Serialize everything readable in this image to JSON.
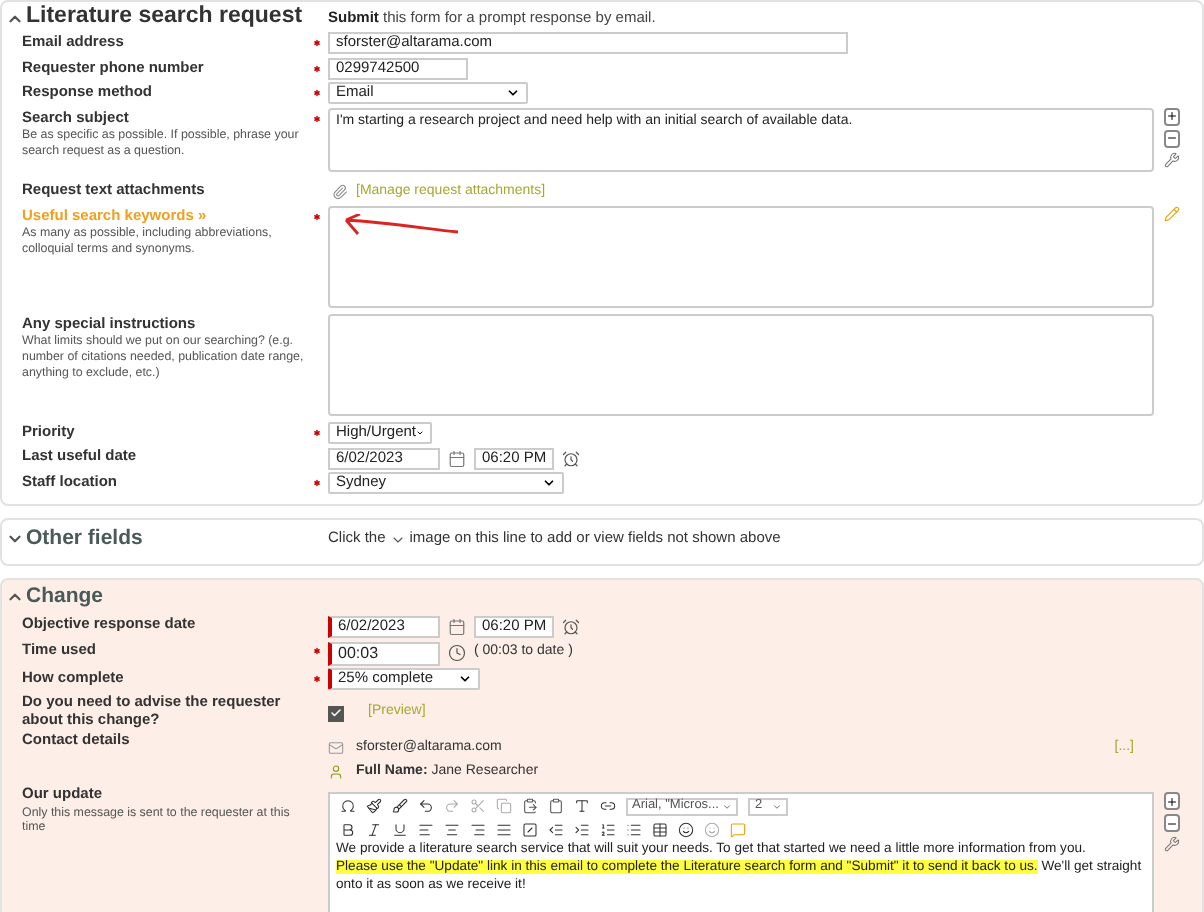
{
  "sections": [
    {
      "kind": "form",
      "title": "Literature search request",
      "expanded": true,
      "intro": "**Submit** this form for a prompt response by email.",
      "rows": [
        {
          "kind": "text",
          "label": "Email address",
          "required": true,
          "value": "sforster@altarama.com",
          "wide": true
        },
        {
          "kind": "text",
          "label": "Requester phone number",
          "required": true,
          "value": "0299742500",
          "wide": false
        },
        {
          "kind": "select",
          "label": "Response method",
          "required": true,
          "value": "Email"
        },
        {
          "kind": "textarea",
          "label": "Search subject",
          "hint": "Be as specific as possible. If possible, phrase your search request as a question.",
          "required": true,
          "value": "I'm starting a research project and need help with an initial search of available data.",
          "tools": true
        },
        {
          "kind": "attachments",
          "label": "Request text attachments",
          "required": false,
          "link": "[Manage request attachments]"
        },
        {
          "kind": "textarea",
          "label": "Useful search keywords »",
          "label_link": true,
          "hint": "As many as possible, including abbreviations, colloquial terms and synonyms.",
          "required": true,
          "value": "",
          "tools": false,
          "edit_icon": true,
          "annotated": true
        },
        {
          "kind": "textarea",
          "label": "Any special instructions",
          "hint": "What limits should we put on our searching? (e.g. number of citations needed, publication date range, anything to exclude, etc.)",
          "required": false,
          "value": "",
          "tools": false
        },
        {
          "kind": "select",
          "label": "Priority",
          "required": true,
          "value": "High/Urgent"
        },
        {
          "kind": "datetime",
          "label": "Last useful date",
          "required": false,
          "date": "6/02/2023",
          "time": "06:20 PM",
          "flagged": false
        },
        {
          "kind": "select",
          "label": "Staff location",
          "required": true,
          "value": "Sydney",
          "wide": true
        }
      ]
    },
    {
      "kind": "collapsed",
      "title": "Other fields",
      "expanded": false,
      "note_before": "Click the",
      "note_after": "image on this line to add or view fields not shown above"
    },
    {
      "kind": "form",
      "title": "Change",
      "expanded": true,
      "tinted": true,
      "rows": [
        {
          "kind": "datetime",
          "label": "Objective response date",
          "required": false,
          "date": "6/02/2023",
          "time": "06:20 PM",
          "flagged": true
        },
        {
          "kind": "timeused",
          "label": "Time used",
          "required": true,
          "value": "00:03",
          "note": "( 00:03 to date )",
          "flagged": true
        },
        {
          "kind": "select",
          "label": "How complete",
          "required": true,
          "value": "25% complete",
          "flagged": true
        },
        {
          "kind": "checkbox",
          "label": "Do you need to advise the requester about this change?",
          "required": false,
          "checked": true,
          "link": "[Preview]"
        },
        {
          "kind": "contact",
          "label": "Contact details",
          "required": false,
          "email": "sforster@altarama.com",
          "name": "**Full Name:** Jane Researcher",
          "link": "[...]"
        },
        {
          "kind": "editor",
          "label": "Our update",
          "hint": "Only this message is sent to the requester at this time",
          "required": false,
          "font": "Arial, \"Micros...",
          "size": "2",
          "paragraphs": [
            [
              {
                "text": "We provide a literature search service that will suit your needs.  To get that started we need a little more information from you.",
                "highlighted": false
              }
            ],
            [
              {
                "text": "Please use the \"Update\" link in this email to complete the Literature search form and \"Submit\" it to send it back to us.",
                "highlighted": true
              },
              {
                "text": "  We'll get straight onto it as soon as we receive it!",
                "highlighted": false
              }
            ]
          ]
        }
      ]
    }
  ]
}
